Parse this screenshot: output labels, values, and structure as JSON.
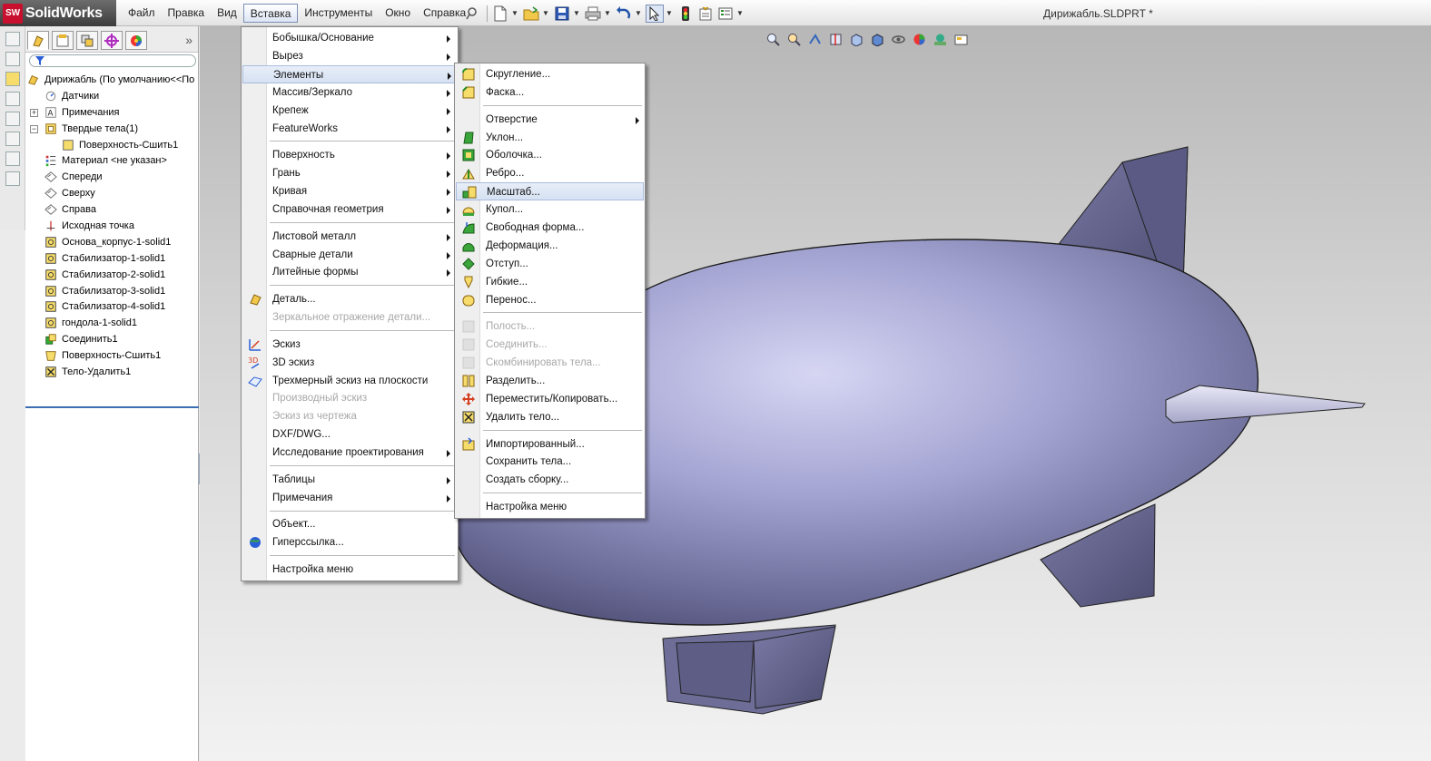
{
  "app": {
    "name_solid": "Solid",
    "name_works": "Works",
    "logo_mark": "SW"
  },
  "menubar": {
    "items": [
      {
        "label": "Файл"
      },
      {
        "label": "Правка"
      },
      {
        "label": "Вид"
      },
      {
        "label": "Вставка",
        "active": true
      },
      {
        "label": "Инструменты"
      },
      {
        "label": "Окно"
      },
      {
        "label": "Справка"
      }
    ]
  },
  "toolbar": {
    "icons": [
      "pin-icon",
      "new-document-icon",
      "open-folder-icon",
      "save-icon",
      "print-icon",
      "undo-icon",
      "select-arrow-icon",
      "rebuild-icon",
      "file-properties-icon",
      "options-icon"
    ]
  },
  "document": {
    "title": "Дирижабль.SLDPRT *"
  },
  "feature_tree": {
    "tabs": [
      "featuremanager-tab-icon",
      "propertymanager-tab-icon",
      "configurationmanager-tab-icon",
      "dimxpert-tab-icon",
      "display-manager-tab-icon"
    ],
    "expand_label": "»",
    "items": [
      {
        "label": "Дирижабль  (По умолчанию<<По",
        "icon": "part-icon",
        "indent": 0,
        "expander": ""
      },
      {
        "label": "Датчики",
        "icon": "sensors-icon",
        "indent": 1,
        "expander": ""
      },
      {
        "label": "Примечания",
        "icon": "annotations-icon",
        "indent": 1,
        "expander": "+"
      },
      {
        "label": "Твердые тела(1)",
        "icon": "solid-bodies-icon",
        "indent": 1,
        "expander": "−"
      },
      {
        "label": "Поверхность-Сшить1",
        "icon": "body-icon",
        "indent": 2,
        "expander": ""
      },
      {
        "label": "Материал <не указан>",
        "icon": "material-icon",
        "indent": 1,
        "expander": ""
      },
      {
        "label": "Спереди",
        "icon": "plane-icon",
        "indent": 1,
        "expander": ""
      },
      {
        "label": "Сверху",
        "icon": "plane-icon",
        "indent": 1,
        "expander": ""
      },
      {
        "label": "Справа",
        "icon": "plane-icon",
        "indent": 1,
        "expander": ""
      },
      {
        "label": "Исходная точка",
        "icon": "origin-icon",
        "indent": 1,
        "expander": ""
      },
      {
        "label": "Основа_корпус-1-solid1",
        "icon": "imported-body-icon",
        "indent": 1,
        "expander": ""
      },
      {
        "label": "Стабилизатор-1-solid1",
        "icon": "imported-body-icon",
        "indent": 1,
        "expander": ""
      },
      {
        "label": "Стабилизатор-2-solid1",
        "icon": "imported-body-icon",
        "indent": 1,
        "expander": ""
      },
      {
        "label": "Стабилизатор-3-solid1",
        "icon": "imported-body-icon",
        "indent": 1,
        "expander": ""
      },
      {
        "label": "Стабилизатор-4-solid1",
        "icon": "imported-body-icon",
        "indent": 1,
        "expander": ""
      },
      {
        "label": "гондола-1-solid1",
        "icon": "imported-body-icon",
        "indent": 1,
        "expander": ""
      },
      {
        "label": "Соединить1",
        "icon": "combine-icon",
        "indent": 1,
        "expander": ""
      },
      {
        "label": "Поверхность-Сшить1",
        "icon": "knit-surface-icon",
        "indent": 1,
        "expander": ""
      },
      {
        "label": "Тело-Удалить1",
        "icon": "delete-body-icon",
        "indent": 1,
        "expander": ""
      }
    ]
  },
  "insert_menu": {
    "items": [
      {
        "label": "Бобышка/Основание",
        "submenu": true,
        "icon": ""
      },
      {
        "label": "Вырез",
        "submenu": true,
        "icon": ""
      },
      {
        "label": "Элементы",
        "submenu": true,
        "icon": "",
        "highlight": true
      },
      {
        "label": "Массив/Зеркало",
        "submenu": true,
        "icon": ""
      },
      {
        "label": "Крепеж",
        "submenu": true,
        "icon": ""
      },
      {
        "label": "FeatureWorks",
        "submenu": true,
        "icon": ""
      },
      {
        "sep": true
      },
      {
        "label": "Поверхность",
        "submenu": true,
        "icon": ""
      },
      {
        "label": "Грань",
        "submenu": true,
        "icon": ""
      },
      {
        "label": "Кривая",
        "submenu": true,
        "icon": ""
      },
      {
        "label": "Справочная геометрия",
        "submenu": true,
        "icon": ""
      },
      {
        "sep": true
      },
      {
        "label": "Листовой металл",
        "submenu": true,
        "icon": ""
      },
      {
        "label": "Сварные детали",
        "submenu": true,
        "icon": ""
      },
      {
        "label": "Литейные формы",
        "submenu": true,
        "icon": ""
      },
      {
        "sep": true
      },
      {
        "label": "Деталь...",
        "icon": "part-insert-icon"
      },
      {
        "label": "Зеркальное отражение детали...",
        "disabled": true,
        "icon": ""
      },
      {
        "sep": true
      },
      {
        "label": "Эскиз",
        "icon": "sketch-icon"
      },
      {
        "label": "3D эскиз",
        "icon": "3d-sketch-icon"
      },
      {
        "label": "Трехмерный эскиз на плоскости",
        "icon": "3d-sketch-plane-icon"
      },
      {
        "label": "Производный эскиз",
        "disabled": true,
        "icon": ""
      },
      {
        "label": "Эскиз из чертежа",
        "disabled": true,
        "icon": ""
      },
      {
        "label": "DXF/DWG...",
        "icon": ""
      },
      {
        "label": "Исследование проектирования",
        "submenu": true,
        "icon": ""
      },
      {
        "sep": true
      },
      {
        "label": "Таблицы",
        "submenu": true,
        "icon": ""
      },
      {
        "label": "Примечания",
        "submenu": true,
        "icon": ""
      },
      {
        "sep": true
      },
      {
        "label": "Объект...",
        "icon": ""
      },
      {
        "label": "Гиперссылка...",
        "icon": "hyperlink-globe-icon"
      },
      {
        "sep": true
      },
      {
        "label": "Настройка меню",
        "icon": ""
      }
    ]
  },
  "features_submenu": {
    "items": [
      {
        "label": "Скругление...",
        "icon": "fillet-icon"
      },
      {
        "label": "Фаска...",
        "icon": "chamfer-icon"
      },
      {
        "sep": true
      },
      {
        "label": "Отверстие",
        "submenu": true,
        "icon": ""
      },
      {
        "label": "Уклон...",
        "icon": "draft-icon"
      },
      {
        "label": "Оболочка...",
        "icon": "shell-icon"
      },
      {
        "label": "Ребро...",
        "icon": "rib-icon"
      },
      {
        "label": "Масштаб...",
        "icon": "scale-icon",
        "highlight": true
      },
      {
        "label": "Купол...",
        "icon": "dome-icon"
      },
      {
        "label": "Свободная форма...",
        "icon": "freeform-icon"
      },
      {
        "label": "Деформация...",
        "icon": "deform-icon"
      },
      {
        "label": "Отступ...",
        "icon": "indent-icon"
      },
      {
        "label": "Гибкие...",
        "icon": "flex-icon"
      },
      {
        "label": "Перенос...",
        "icon": "wrap-icon"
      },
      {
        "sep": true
      },
      {
        "label": "Полость...",
        "disabled": true,
        "icon": "cavity-icon"
      },
      {
        "label": "Соединить...",
        "disabled": true,
        "icon": "join-icon"
      },
      {
        "label": "Скомбинировать тела...",
        "disabled": true,
        "icon": "combine-bodies-icon"
      },
      {
        "label": "Разделить...",
        "icon": "split-icon"
      },
      {
        "label": "Переместить/Копировать...",
        "icon": "move-copy-icon"
      },
      {
        "label": "Удалить тело...",
        "icon": "delete-body-icon"
      },
      {
        "sep": true
      },
      {
        "label": "Импортированный...",
        "icon": "imported-icon"
      },
      {
        "label": "Сохранить тела...",
        "icon": ""
      },
      {
        "label": "Создать сборку...",
        "icon": ""
      },
      {
        "sep": true
      },
      {
        "label": "Настройка меню",
        "icon": ""
      }
    ]
  },
  "heads_up_toolbar": {
    "icons": [
      "zoom-to-fit-icon",
      "zoom-area-icon",
      "previous-view-icon",
      "section-view-icon",
      "view-orientation-icon",
      "display-style-icon",
      "hide-show-icon",
      "appearance-icon",
      "scene-icon",
      "view-settings-icon"
    ]
  },
  "colors": {
    "airship_light": "#c9c9ee",
    "airship_mid": "#8f8fc0",
    "airship_dark": "#545478",
    "highlight_border": "#a9bcdd",
    "selection_blue": "#3c6eb4"
  }
}
